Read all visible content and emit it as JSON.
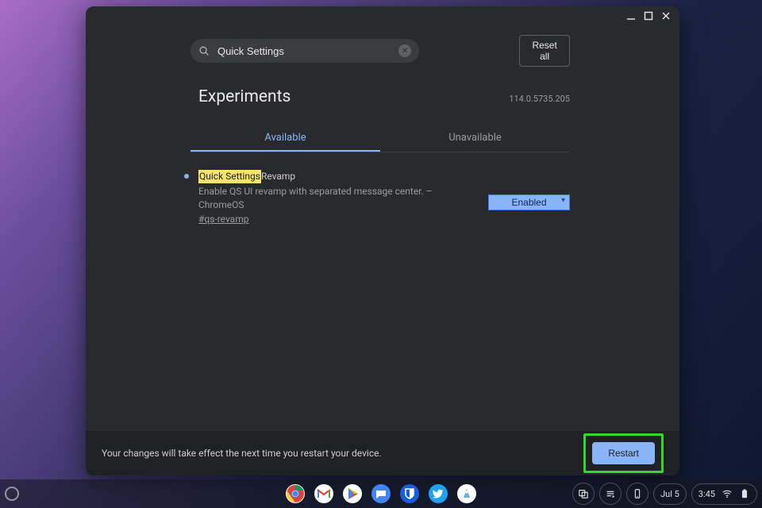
{
  "window": {
    "search_value": "Quick Settings",
    "reset_label": "Reset all",
    "heading": "Experiments",
    "version": "114.0.5735.205",
    "tabs": {
      "available": "Available",
      "unavailable": "Unavailable"
    }
  },
  "flag": {
    "highlight_part": "Quick Settings",
    "title_rest": " Revamp",
    "description": "Enable QS UI revamp with separated message center. – ChromeOS",
    "hash": "#qs-revamp",
    "selected": "Enabled"
  },
  "restart": {
    "message": "Your changes will take effect the next time you restart your device.",
    "button": "Restart"
  },
  "shelf": {
    "date": "Jul 5",
    "time": "3:45"
  }
}
